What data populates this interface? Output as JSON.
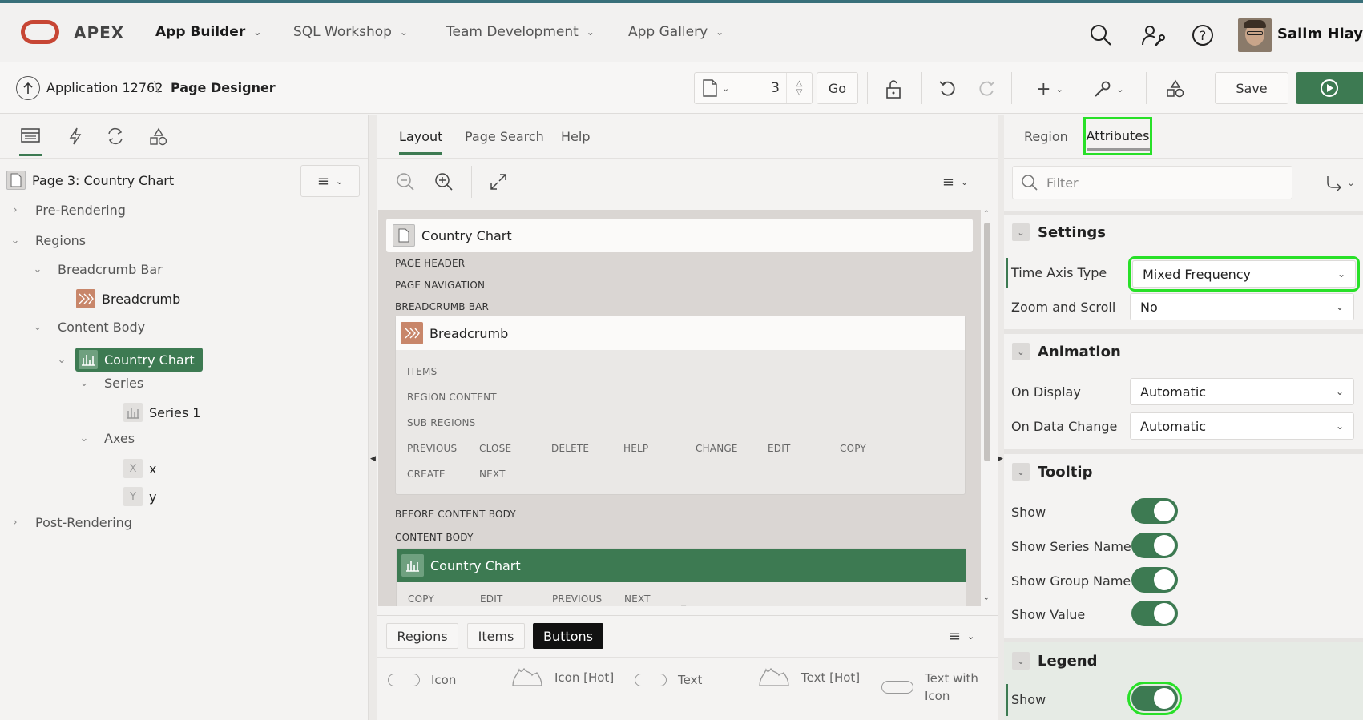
{
  "topbar": {
    "logo": "APEX",
    "nav": [
      "App Builder",
      "SQL Workshop",
      "Team Development",
      "App Gallery"
    ],
    "user": "Salim Hlayel"
  },
  "subbar": {
    "breadcrumb_app": "Application 12762",
    "breadcrumb_sep": "\\",
    "breadcrumb_page": "Page Designer",
    "page_number": "3",
    "go_label": "Go",
    "save_label": "Save"
  },
  "left": {
    "page_title": "Page 3: Country Chart",
    "tree": {
      "pre_rendering": "Pre-Rendering",
      "regions": "Regions",
      "breadcrumb_bar": "Breadcrumb Bar",
      "breadcrumb": "Breadcrumb",
      "content_body": "Content Body",
      "country_chart": "Country Chart",
      "series": "Series",
      "series1": "Series 1",
      "axes": "Axes",
      "x": "x",
      "y": "y",
      "post_rendering": "Post-Rendering",
      "x_icon": "X",
      "y_icon": "Y"
    }
  },
  "middle": {
    "tabs": [
      "Layout",
      "Page Search",
      "Help"
    ],
    "page_title": "Country Chart",
    "sections": {
      "page_header": "PAGE HEADER",
      "page_navigation": "PAGE NAVIGATION",
      "breadcrumb_bar": "BREADCRUMB BAR",
      "before_content_body": "BEFORE CONTENT BODY",
      "content_body": "CONTENT BODY"
    },
    "breadcrumb_region": {
      "title": "Breadcrumb",
      "rows": [
        "ITEMS",
        "REGION CONTENT",
        "SUB REGIONS"
      ],
      "positions1": [
        "PREVIOUS",
        "CLOSE",
        "DELETE",
        "HELP",
        "CHANGE",
        "EDIT",
        "COPY"
      ],
      "positions2": [
        "CREATE",
        "NEXT"
      ]
    },
    "chart_region": {
      "title": "Country Chart",
      "positions": [
        "COPY",
        "EDIT",
        "PREVIOUS",
        "NEXT"
      ]
    },
    "gallery_tabs": [
      "Regions",
      "Items",
      "Buttons"
    ],
    "gallery_items": [
      "Icon",
      "Icon [Hot]",
      "Text",
      "Text [Hot]",
      "Text with Icon"
    ]
  },
  "right": {
    "tabs": [
      "Region",
      "Attributes"
    ],
    "filter_placeholder": "Filter",
    "sections": {
      "settings": {
        "title": "Settings",
        "time_axis_type_label": "Time Axis Type",
        "time_axis_type_value": "Mixed Frequency",
        "zoom_label": "Zoom and Scroll",
        "zoom_value": "No"
      },
      "animation": {
        "title": "Animation",
        "on_display_label": "On Display",
        "on_display_value": "Automatic",
        "on_data_change_label": "On Data Change",
        "on_data_change_value": "Automatic"
      },
      "tooltip": {
        "title": "Tooltip",
        "show": "Show",
        "show_series_name": "Show Series Name",
        "show_group_name": "Show Group Name",
        "show_value": "Show Value"
      },
      "legend": {
        "title": "Legend",
        "show": "Show"
      }
    }
  },
  "colors": {
    "accent": "#3d7a52",
    "topbar_border": "#39707a",
    "highlight": "#28e028",
    "oracle_red": "#c74634"
  }
}
